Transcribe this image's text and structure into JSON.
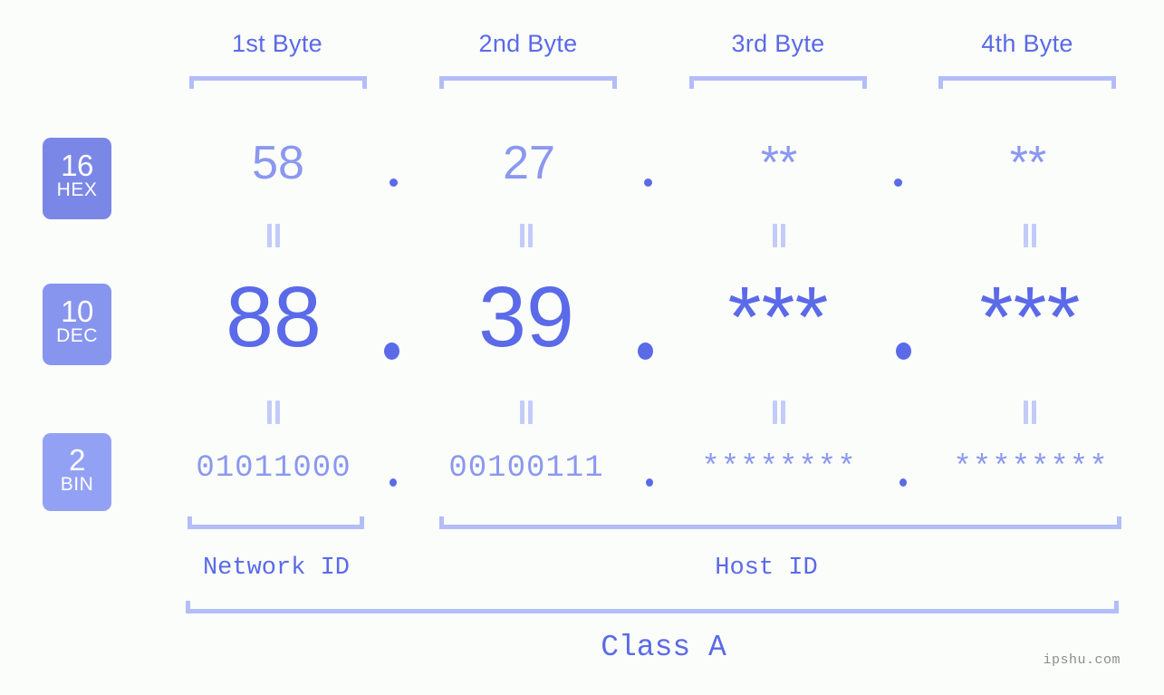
{
  "background_color": "#fbfdfa",
  "accent_color": "#5a6ae8",
  "muted_accent_color": "#8b98ef",
  "bracket_color": "#b3bdf7",
  "header": {
    "byte_labels": [
      "1st Byte",
      "2nd Byte",
      "3rd Byte",
      "4th Byte"
    ]
  },
  "bases": [
    {
      "number": "16",
      "name": "HEX",
      "color": "#7a87e6"
    },
    {
      "number": "10",
      "name": "DEC",
      "color": "#8795ee"
    },
    {
      "number": "2",
      "name": "BIN",
      "color": "#93a1f5"
    }
  ],
  "rows": {
    "hex": {
      "values": [
        "58",
        "27",
        "**",
        "**"
      ],
      "separator": "."
    },
    "dec": {
      "values": [
        "88",
        "39",
        "***",
        "***"
      ],
      "separator": "."
    },
    "bin": {
      "values": [
        "01011000",
        "00100111",
        "********",
        "********"
      ],
      "separator": "."
    }
  },
  "equals_symbol": "=",
  "sections": {
    "network_id": "Network ID",
    "host_id": "Host ID",
    "class": "Class A"
  },
  "watermark": "ipshu.com"
}
